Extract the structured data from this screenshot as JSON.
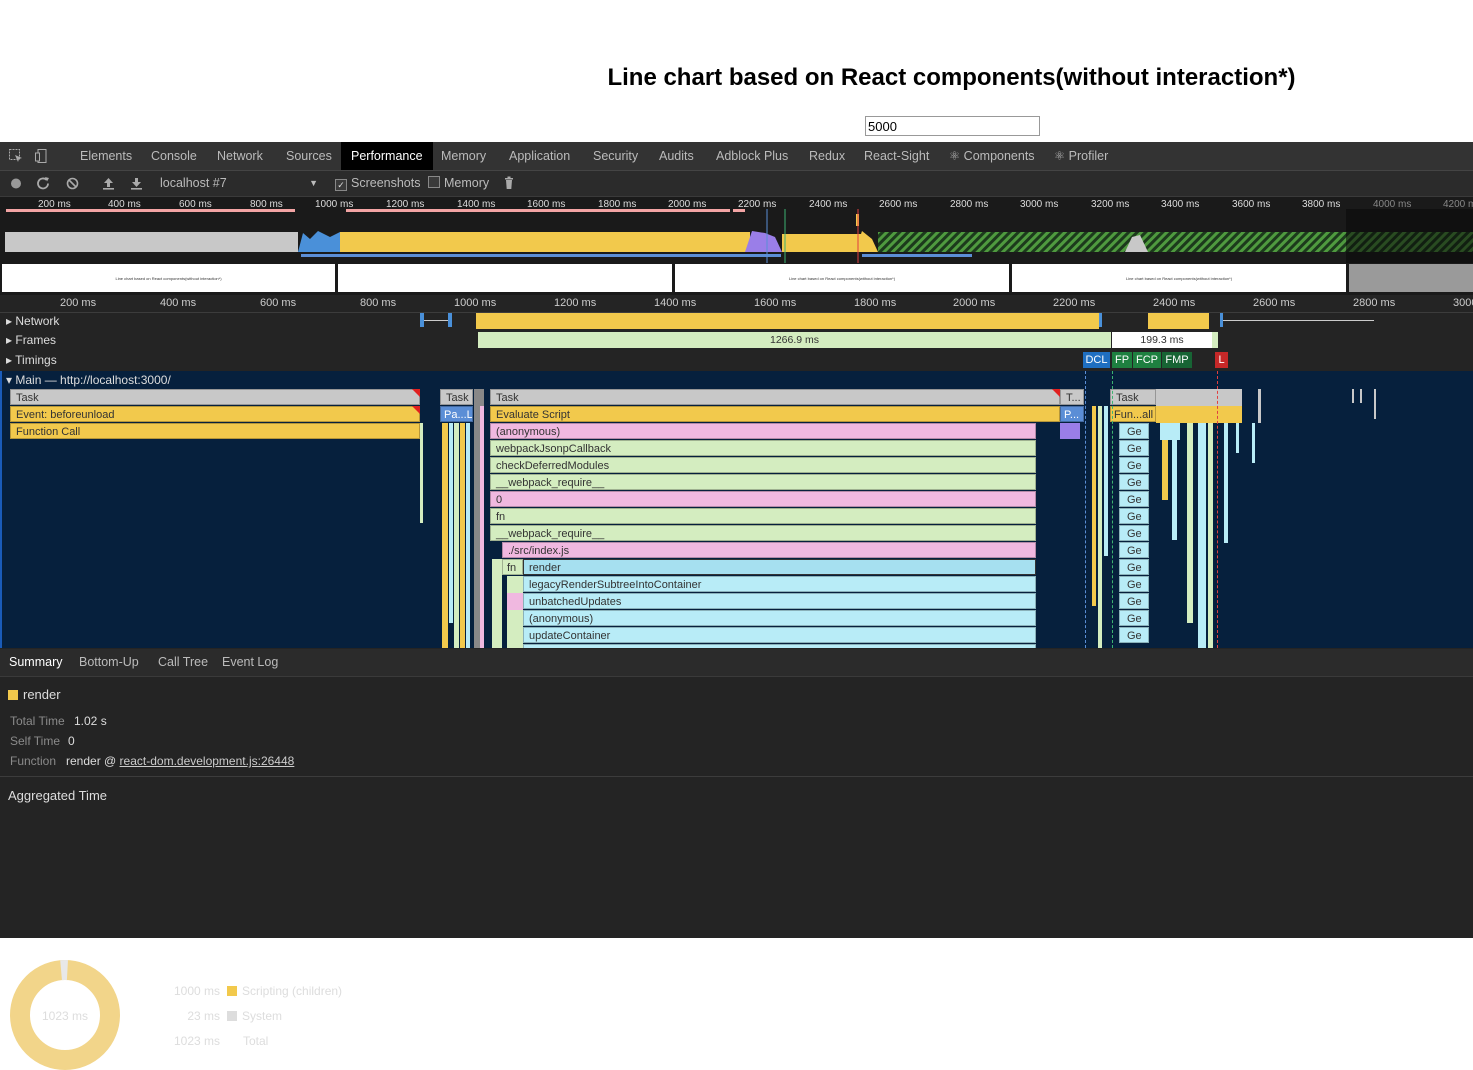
{
  "page": {
    "title": "Line chart based on React components(without interaction*)",
    "input_value": "5000"
  },
  "devtools": {
    "tabs": [
      "Elements",
      "Console",
      "Network",
      "Sources",
      "Performance",
      "Memory",
      "Application",
      "Security",
      "Audits",
      "Adblock Plus",
      "Redux",
      "React-Sight",
      "⚛ Components",
      "⚛ Profiler"
    ],
    "active_tab": "Performance",
    "toolbar": {
      "profile_select": "localhost #7",
      "screenshots_label": "Screenshots",
      "screenshots_checked": true,
      "memory_label": "Memory",
      "memory_checked": false
    },
    "overview_ticks": [
      "200 ms",
      "400 ms",
      "600 ms",
      "800 ms",
      "1000 ms",
      "1200 ms",
      "1400 ms",
      "1600 ms",
      "1800 ms",
      "2000 ms",
      "2200 ms",
      "2400 ms",
      "2600 ms",
      "2800 ms",
      "3000 ms",
      "3200 ms",
      "3400 ms",
      "3600 ms",
      "3800 ms",
      "4000 ms",
      "4200 ms"
    ],
    "screenshot_caption": "Line chart based on React components(without interaction*)",
    "ruler_ticks": [
      "200 ms",
      "400 ms",
      "600 ms",
      "800 ms",
      "1000 ms",
      "1200 ms",
      "1400 ms",
      "1600 ms",
      "1800 ms",
      "2000 ms",
      "2200 ms",
      "2400 ms",
      "2600 ms",
      "2800 ms",
      "3000"
    ],
    "tracks": {
      "network": "Network",
      "frames": "Frames",
      "frame_long": "1266.9 ms",
      "frame_short": "199.3 ms",
      "timings": "Timings",
      "markers": [
        "DCL",
        "FP",
        "FCP",
        "FMP",
        "L"
      ],
      "main": "Main — http://localhost:3000/"
    },
    "flame": {
      "task": "Task",
      "task_short": "T...",
      "event_beforeunload": "Event: beforeunload",
      "function_call": "Function Call",
      "pa": "Pa...L",
      "p": "P...",
      "fun_all": "Fun...all",
      "evaluate_script": "Evaluate Script",
      "anonymous": "(anonymous)",
      "webpack_jsonp": "webpackJsonpCallback",
      "check_deferred": "checkDeferredModules",
      "webpack_require": "__webpack_require__",
      "zero": "0",
      "fn": "fn",
      "src_index": "./src/index.js",
      "render": "render",
      "legacy_render": "legacyRenderSubtreeIntoContainer",
      "unbatched": "unbatchedUpdates",
      "update_container": "updateContainer",
      "ge": "Ge"
    },
    "bottom_tabs": [
      "Summary",
      "Bottom-Up",
      "Call Tree",
      "Event Log"
    ],
    "active_bottom_tab": "Summary",
    "summary": {
      "name": "render",
      "total_time_label": "Total Time",
      "total_time": "1.02 s",
      "self_time_label": "Self Time",
      "self_time": "0",
      "function_label": "Function",
      "function_prefix": "render @",
      "function_link": "react-dom.development.js:26448",
      "aggregated_title": "Aggregated Time",
      "donut_center": "1023 ms",
      "rows": [
        {
          "value": "1000 ms",
          "label": "Scripting (children)",
          "color": "#f2c94c"
        },
        {
          "value": "23 ms",
          "label": "System",
          "color": "#dddddd"
        },
        {
          "value": "1023 ms",
          "label": "Total",
          "color": ""
        }
      ]
    }
  },
  "colors": {
    "scripting": "#f2c94c",
    "task": "#c8c8c8",
    "pink": "#f0b8e0",
    "green": "#d4edc0",
    "cyan": "#a6e0f0",
    "purple": "#9a7ee8"
  }
}
